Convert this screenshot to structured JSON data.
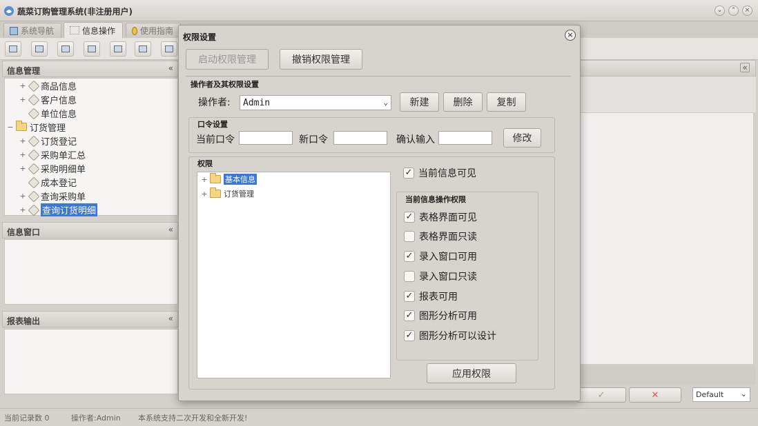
{
  "app": {
    "title": "蔬菜订购管理系统(非注册用户)"
  },
  "tabs": [
    {
      "label": "系统导航"
    },
    {
      "label": "信息操作"
    },
    {
      "label": "使用指南"
    }
  ],
  "left_panel": {
    "header": "信息管理",
    "collapse": "«",
    "tree": [
      {
        "label": "商品信息",
        "expander": "+"
      },
      {
        "label": "客户信息",
        "expander": "+"
      },
      {
        "label": "单位信息",
        "expander": ""
      },
      {
        "label": "订货管理",
        "expander": "−"
      },
      {
        "label": "订货登记",
        "expander": "+"
      },
      {
        "label": "采购单汇总",
        "expander": "+"
      },
      {
        "label": "采购明细单",
        "expander": "+"
      },
      {
        "label": "成本登记",
        "expander": ""
      },
      {
        "label": "查询采购单",
        "expander": "+"
      },
      {
        "label": "查询订货明细",
        "expander": "+"
      }
    ]
  },
  "info_panel": {
    "header": "信息窗口",
    "collapse": "«"
  },
  "report_panel": {
    "header": "报表输出",
    "collapse": "«"
  },
  "right_panel": {
    "collapse": "«",
    "bottom_select": "Default"
  },
  "status": {
    "records": "当前记录数 0",
    "operator": "操作者:Admin",
    "message": "本系统支持二次开发和全新开发!"
  },
  "dialog": {
    "title": "权限设置",
    "close": "×",
    "enable_btn": "启动权限管理",
    "revoke_btn": "撤销权限管理",
    "operator_group": "操作者及其权限设置",
    "operator_label": "操作者:",
    "operator_value": "Admin",
    "new_btn": "新建",
    "delete_btn": "删除",
    "copy_btn": "复制",
    "password_group": "口令设置",
    "current_pwd": "当前口令",
    "new_pwd": "新口令",
    "confirm_pwd": "确认输入",
    "modify_btn": "修改",
    "perm_group": "权限",
    "perm_tree": [
      {
        "label": "基本信息",
        "expander": "+",
        "selected": true
      },
      {
        "label": "订货管理",
        "expander": "+",
        "selected": false
      }
    ],
    "visible_label": "当前信息可见",
    "ops_group": "当前信息操作权限",
    "ops": [
      {
        "label": "表格界面可见",
        "checked": true
      },
      {
        "label": "表格界面只读",
        "checked": false
      },
      {
        "label": "录入窗口可用",
        "checked": true
      },
      {
        "label": "录入窗口只读",
        "checked": false
      },
      {
        "label": "报表可用",
        "checked": true
      },
      {
        "label": "图形分析可用",
        "checked": true
      },
      {
        "label": "图形分析可以设计",
        "checked": true
      }
    ],
    "apply_btn": "应用权限"
  }
}
